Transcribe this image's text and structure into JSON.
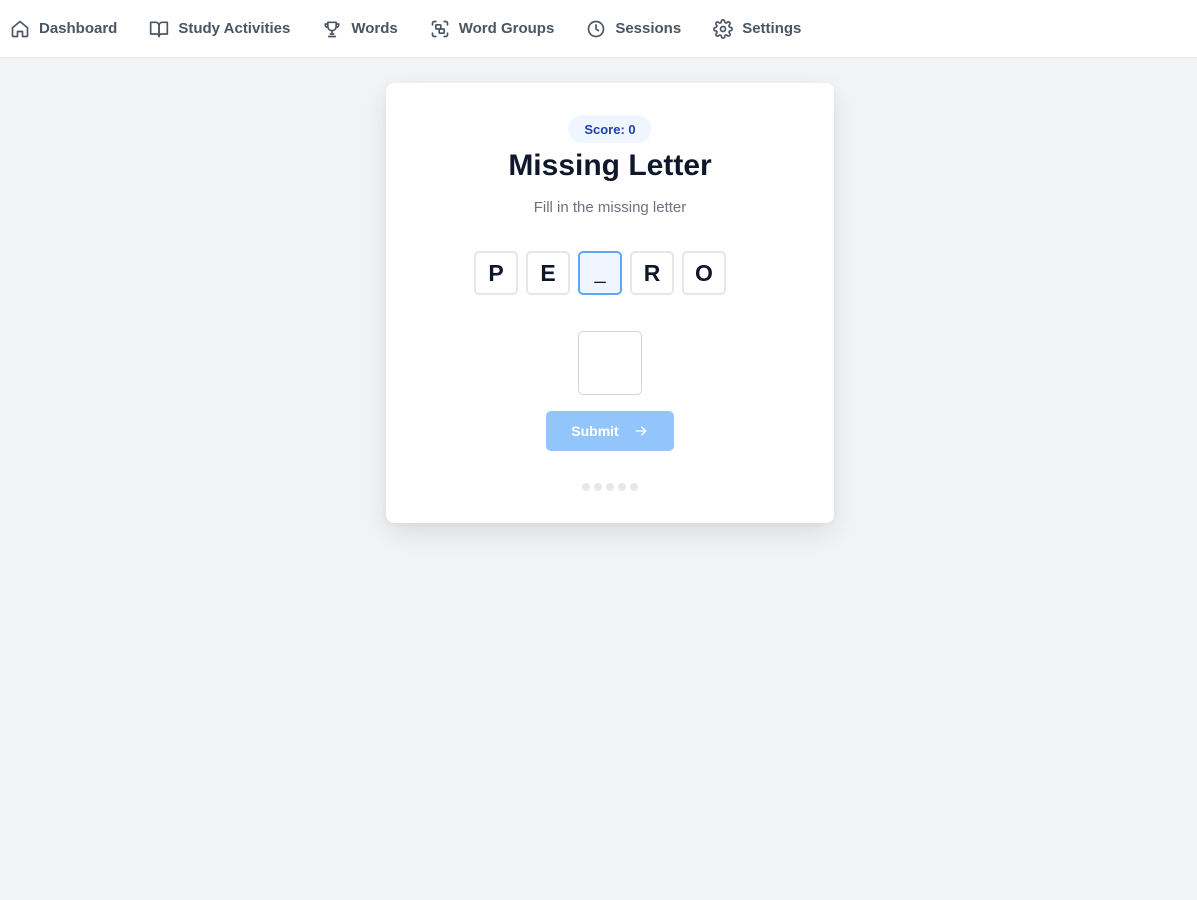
{
  "nav": {
    "items": [
      {
        "label": "Dashboard",
        "icon": "home-icon"
      },
      {
        "label": "Study Activities",
        "icon": "book-open-icon"
      },
      {
        "label": "Words",
        "icon": "trophy-icon"
      },
      {
        "label": "Word Groups",
        "icon": "group-icon"
      },
      {
        "label": "Sessions",
        "icon": "clock-icon"
      },
      {
        "label": "Settings",
        "icon": "gear-icon"
      }
    ]
  },
  "game": {
    "score_text": "Score: 0",
    "title": "Missing Letter",
    "subtitle": "Fill in the missing letter",
    "letters": [
      "P",
      "E",
      "_",
      "R",
      "O"
    ],
    "missing_index": 2,
    "answer_value": "",
    "submit_label": "Submit",
    "submit_icon": "arrow-right-icon",
    "progress_total": 5,
    "progress_completed": 0
  },
  "colors": {
    "accent": "#3b82f6",
    "submit_disabled": "#93c5fd",
    "score_bg": "#eff6ff",
    "score_text": "#1e40af",
    "background": "#f3f4f6"
  }
}
